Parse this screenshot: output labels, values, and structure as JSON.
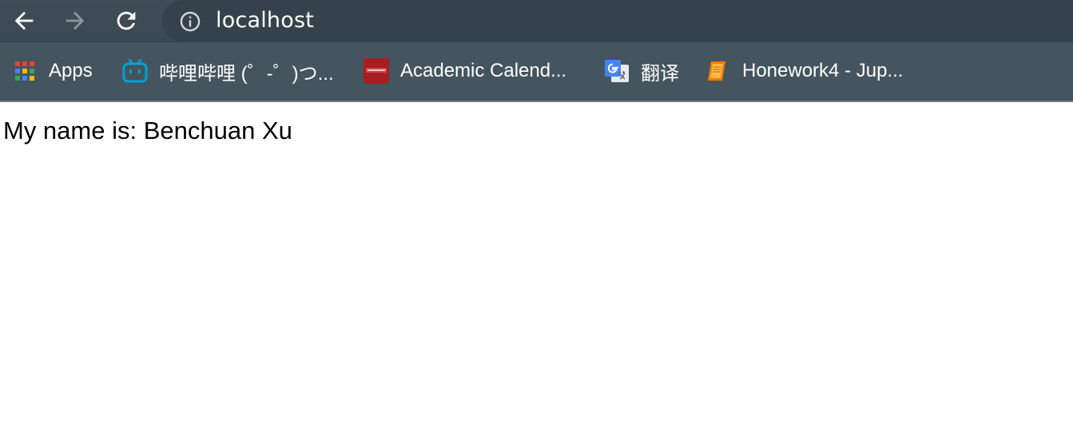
{
  "toolbar": {
    "back_icon": "back-arrow-icon",
    "forward_icon": "forward-arrow-icon",
    "reload_icon": "reload-icon",
    "address": {
      "info_icon": "info-icon",
      "url": "localhost"
    }
  },
  "bookmarks": [
    {
      "label": "Apps",
      "icon": "apps-grid-icon"
    },
    {
      "label": "哔哩哔哩 (゜-゜)つ...",
      "icon": "bilibili-icon"
    },
    {
      "label": "Academic Calend...",
      "icon": "sjtu-icon"
    },
    {
      "label": "翻译",
      "icon": "google-translate-icon"
    },
    {
      "label": "Honework4 - Jup...",
      "icon": "book-icon"
    }
  ],
  "page": {
    "text": "My name is: Benchuan Xu"
  }
}
